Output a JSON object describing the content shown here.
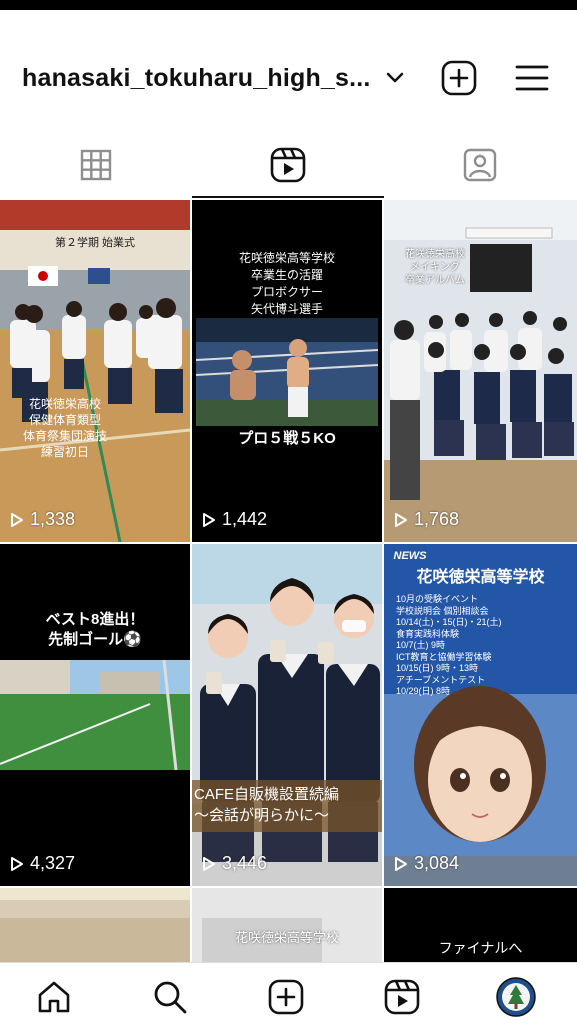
{
  "header": {
    "username": "hanasaki_tokuharu_high_s...",
    "icons": [
      "chevron-down-icon",
      "add-icon",
      "menu-icon"
    ]
  },
  "tabs": [
    "grid-icon",
    "reels-icon",
    "tagged-icon"
  ],
  "tiles": [
    {
      "views": "1,338",
      "caption": "花咲徳栄高校\n保健体育類型\n体育祭集団演技\n練習初日",
      "banner": "第２学期 始業式"
    },
    {
      "views": "1,442",
      "caption": "花咲徳栄高等学校\n卒業生の活躍\nプロボクサー\n矢代博斗選手",
      "subcaption": "プロ５戦５KO"
    },
    {
      "views": "1,768",
      "caption": "花咲徳栄高校\nメイキング\n卒業アルバム"
    },
    {
      "views": "4,327",
      "caption": "ベスト8進出！\n先制ゴール⚽"
    },
    {
      "views": "3,446",
      "caption": "CAFE自販機設置続編\n〜会話が明らかに〜"
    },
    {
      "views": "3,084",
      "title": "花咲徳栄高等学校",
      "news": "NEWS",
      "info": "10月の受験イベント\n学校説明会 個別相談会\n10/14(土)・15(日)・21(土)\n食育実践科体験\n10/7(土) 9時\nICT教育と協働学習体験\n10/15(日) 9時・13時\nアチーブメントテスト\n10/29(日) 8時"
    },
    {
      "caption": ""
    },
    {
      "caption": "花咲徳栄高等学校"
    },
    {
      "caption": "ファイナルへ"
    }
  ],
  "bottom_nav": [
    "home-icon",
    "search-icon",
    "create-icon",
    "reels-icon",
    "profile-avatar"
  ]
}
